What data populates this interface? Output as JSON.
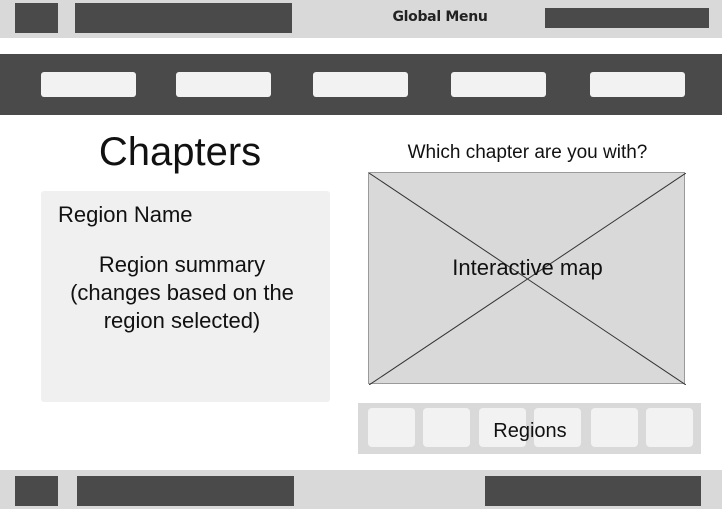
{
  "global_bar": {
    "menu_label": "Global Menu"
  },
  "main_nav": {
    "items": [
      "",
      "",
      "",
      "",
      ""
    ]
  },
  "chapters": {
    "title": "Chapters",
    "region_name": "Region Name",
    "region_summary": "Region summary (changes based on the region selected)"
  },
  "map": {
    "question": "Which chapter are you with?",
    "label": "Interactive map"
  },
  "regions": {
    "label": "Regions",
    "count": 6
  },
  "colors": {
    "dark_bar": "#4a4a4a",
    "light_bar": "#d9d9d9",
    "panel": "#f0f0f0",
    "button": "#f2f2f2"
  }
}
